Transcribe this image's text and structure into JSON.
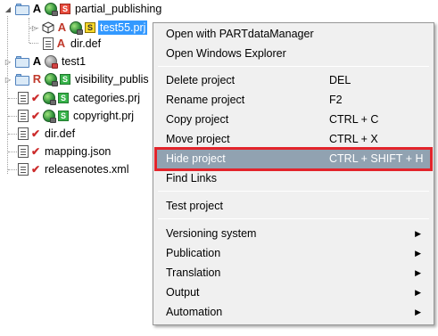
{
  "tree": {
    "nodes": [
      {
        "label": "partial_publishing",
        "status": "A"
      },
      {
        "label": "test55.prj",
        "status": "A"
      },
      {
        "label": "dir.def",
        "status": "A"
      },
      {
        "label": "test1",
        "status": "A"
      },
      {
        "label": "visibility_publis",
        "status": "R"
      },
      {
        "label": "categories.prj",
        "check": "✔"
      },
      {
        "label": "copyright.prj",
        "check": "✔"
      },
      {
        "label": "dir.def",
        "check": "✔"
      },
      {
        "label": "mapping.json",
        "check": "✔"
      },
      {
        "label": "releasenotes.xml",
        "check": "✔"
      }
    ],
    "badges": {
      "partial": "S",
      "test55": "S",
      "visibility": "S",
      "categories": "S",
      "copyright": "S"
    }
  },
  "menu": {
    "open_pdm": "Open with PARTdataManager",
    "open_explorer": "Open Windows Explorer",
    "delete": {
      "label": "Delete project",
      "shortcut": "DEL"
    },
    "rename": {
      "label": "Rename project",
      "shortcut": "F2"
    },
    "copy": {
      "label": "Copy project",
      "shortcut": "CTRL + C"
    },
    "move": {
      "label": "Move project",
      "shortcut": "CTRL + X"
    },
    "hide": {
      "label": "Hide project",
      "shortcut": "CTRL + SHIFT + H"
    },
    "find_links": "Find Links",
    "test_project": "Test project",
    "versioning": "Versioning system",
    "publication": "Publication",
    "translation": "Translation",
    "output": "Output",
    "automation": "Automation",
    "submenu_arrow": "▶"
  },
  "colors": {
    "selection": "#3399ff",
    "menu_highlight": "#91a2b1",
    "highlight_frame": "#e2242b",
    "menu_background": "#f0f0f0"
  }
}
